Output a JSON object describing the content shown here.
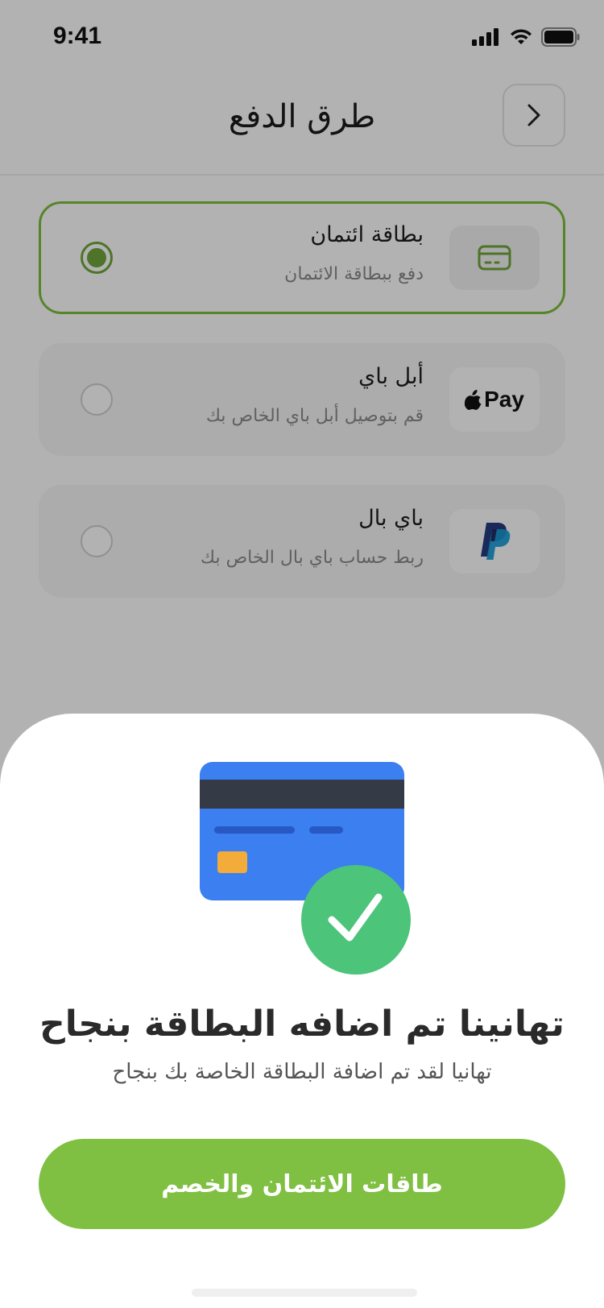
{
  "status_bar": {
    "time": "9:41"
  },
  "header": {
    "title": "طرق الدفع"
  },
  "payment_options": [
    {
      "title": "بطاقة ائتمان",
      "subtitle": "دفع ببطاقة الائتمان",
      "selected": true,
      "icon": "credit-card-icon"
    },
    {
      "title": "أبل باي",
      "subtitle": "قم بتوصيل أبل باي الخاص بك",
      "selected": false,
      "icon": "apple-pay-logo",
      "logo_text": "Pay"
    },
    {
      "title": "باي بال",
      "subtitle": "ربط حساب باي بال الخاص بك",
      "selected": false,
      "icon": "paypal-logo"
    }
  ],
  "sheet": {
    "title": "تهانينا تم اضافه البطاقة بنجاح",
    "subtitle": "تهانيا لقد تم اضافة البطاقة الخاصة بك بنجاح",
    "button_label": "طاقات الائتمان والخصم"
  },
  "colors": {
    "accent": "#7fc042",
    "selected_border": "#7bbf3c",
    "card_blue": "#3b7ff0",
    "check_green": "#4cc47a",
    "chip": "#f3ab3a"
  }
}
